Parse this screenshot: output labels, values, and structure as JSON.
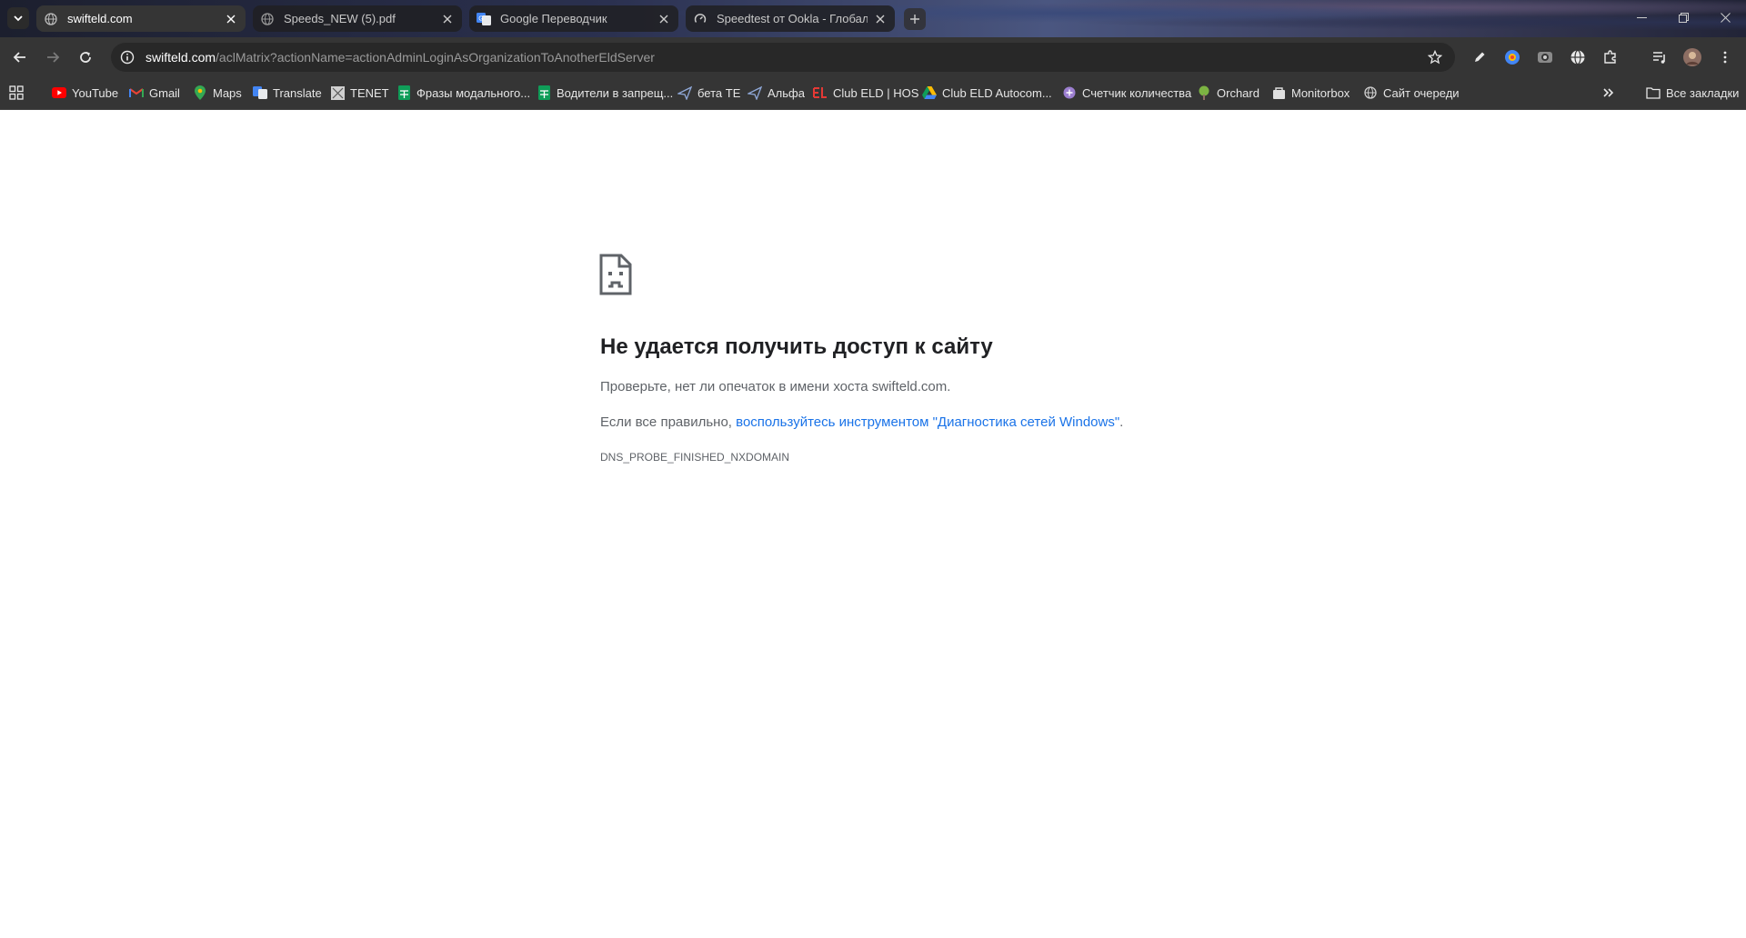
{
  "tabs": [
    {
      "title": "swifteld.com",
      "active": true,
      "favicon": "globe-icon"
    },
    {
      "title": "Speeds_NEW (5).pdf",
      "active": false,
      "favicon": "globe-icon"
    },
    {
      "title": "Google Переводчик",
      "active": false,
      "favicon": "google-translate-icon"
    },
    {
      "title": "Speedtest от Ookla - Глобальн",
      "active": false,
      "favicon": "speedtest-icon"
    }
  ],
  "address_bar": {
    "host": "swifteld.com",
    "path": "/aclMatrix?actionName=actionAdminLoginAsOrganizationToAnotherEldServer"
  },
  "bookmarks": [
    {
      "label": "YouTube",
      "icon": "youtube-icon",
      "color": "#ff0000"
    },
    {
      "label": "Gmail",
      "icon": "gmail-icon",
      "color": "#ea4335"
    },
    {
      "label": "Maps",
      "icon": "maps-icon",
      "color": "#34a853"
    },
    {
      "label": "Translate",
      "icon": "translate-icon",
      "color": "#4285f4"
    },
    {
      "label": "TENET",
      "icon": "tenet-icon",
      "color": "#d0d0d0"
    },
    {
      "label": "Фразы модального...",
      "icon": "sheets-icon",
      "color": "#0f9d58"
    },
    {
      "label": "Водители в запрещ...",
      "icon": "sheets-icon",
      "color": "#0f9d58"
    },
    {
      "label": "бета TE",
      "icon": "plane-icon",
      "color": "#8fa8d8"
    },
    {
      "label": "Альфа",
      "icon": "plane-icon",
      "color": "#8fa8d8"
    },
    {
      "label": "Club ELD | HOS",
      "icon": "club-eld-icon",
      "color": "#e53935"
    },
    {
      "label": "Club ELD Autocom...",
      "icon": "drive-icon",
      "color": "#fbbc04"
    },
    {
      "label": "Счетчик количества",
      "icon": "counter-icon",
      "color": "#9c7fd0"
    },
    {
      "label": "Orchard",
      "icon": "orchard-icon",
      "color": "#7cb342"
    },
    {
      "label": "Monitorbox",
      "icon": "monitorbox-icon",
      "color": "#e0e0e0"
    },
    {
      "label": "Сайт очереди",
      "icon": "globe-icon",
      "color": "#cfcfcf"
    }
  ],
  "all_bookmarks_label": "Все закладки",
  "error": {
    "title": "Не удается получить доступ к сайту",
    "line1": "Проверьте, нет ли опечаток в имени хоста swifteld.com.",
    "line2_prefix": "Если все правильно, ",
    "line2_link": "воспользуйтесь инструментом \"Диагностика сетей Windows\"",
    "line2_suffix": ".",
    "code": "DNS_PROBE_FINISHED_NXDOMAIN"
  },
  "colors": {
    "link": "#1a73e8",
    "toolbar": "#353535",
    "omnibox": "#282828",
    "title_text": "#202124",
    "body_text": "#5f6368"
  }
}
